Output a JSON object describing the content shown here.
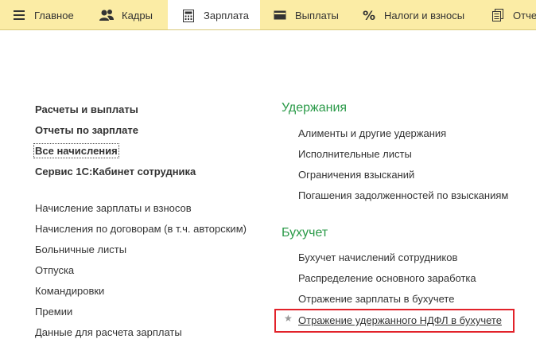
{
  "tabs": [
    {
      "label": "Главное",
      "icon": "hamburger-menu-icon",
      "active": false
    },
    {
      "label": "Кадры",
      "icon": "people-icon",
      "active": false
    },
    {
      "label": "Зарплата",
      "icon": "calculator-icon",
      "active": true
    },
    {
      "label": "Выплаты",
      "icon": "wallet-icon",
      "active": false
    },
    {
      "label": "Налоги и взносы",
      "icon": "percent-icon",
      "active": false
    },
    {
      "label": "Отче",
      "icon": "reports-icon",
      "active": false
    }
  ],
  "left_col": {
    "bold_items": [
      "Расчеты и выплаты",
      "Отчеты по зарплате",
      "Все начисления",
      "Сервис 1С:Кабинет сотрудника"
    ],
    "items": [
      "Начисление зарплаты и взносов",
      "Начисления по договорам (в т.ч. авторским)",
      "Больничные листы",
      "Отпуска",
      "Командировки",
      "Премии",
      "Данные для расчета зарплаты"
    ]
  },
  "right_col": {
    "withholdings": {
      "title": "Удержания",
      "items": [
        "Алименты и другие удержания",
        "Исполнительные листы",
        "Ограничения взысканий",
        "Погашения задолженностей по взысканиям"
      ]
    },
    "accounting": {
      "title": "Бухучет",
      "items": [
        "Бухучет начислений сотрудников",
        "Распределение основного заработка",
        "Отражение зарплаты в бухучете",
        "Отражение удержанного НДФЛ в бухучете"
      ]
    }
  },
  "favorite_star": "★",
  "colors": {
    "topbar": "#fbeca5",
    "section_header": "#2a9a48",
    "highlight_box": "#e2222a"
  }
}
